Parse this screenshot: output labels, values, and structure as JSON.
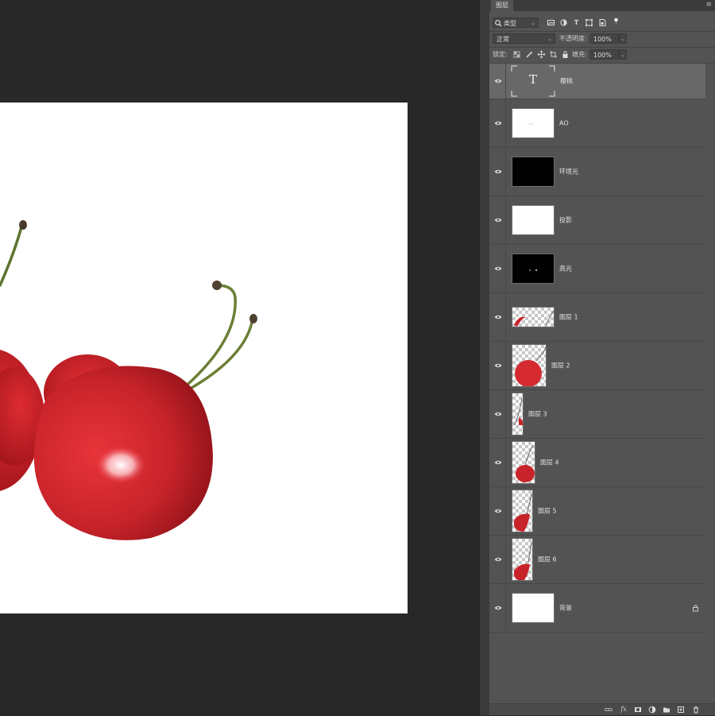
{
  "panel": {
    "tab_title": "图层",
    "menu_icon": "≡",
    "filter": {
      "kind_label": "类型",
      "icons": [
        "image-filter-icon",
        "adjustment-filter-icon",
        "text-filter-icon",
        "shape-filter-icon",
        "smart-object-filter-icon",
        "filter-toggle-icon"
      ]
    },
    "blend_mode": "正常",
    "opacity_label": "不透明度:",
    "opacity_value": "100%",
    "lock_label": "锁定:",
    "fill_label": "填充:",
    "fill_value": "100%"
  },
  "layers": [
    {
      "name": "樱桃",
      "type": "text",
      "visible": true,
      "selected": true,
      "thumb_glyph": "T"
    },
    {
      "name": "AO",
      "type": "pixel",
      "visible": true,
      "thumb": "white"
    },
    {
      "name": "环境光",
      "type": "pixel",
      "visible": true,
      "thumb": "black"
    },
    {
      "name": "投影",
      "type": "pixel",
      "visible": true,
      "thumb": "white"
    },
    {
      "name": "高光",
      "type": "pixel",
      "visible": true,
      "thumb": "black"
    },
    {
      "name": "图层 1",
      "type": "pixel",
      "visible": true,
      "thumb": "transparent"
    },
    {
      "name": "图层 2",
      "type": "pixel",
      "visible": true,
      "thumb": "transparent"
    },
    {
      "name": "图层 3",
      "type": "pixel",
      "visible": true,
      "thumb": "transparent"
    },
    {
      "name": "图层 4",
      "type": "pixel",
      "visible": true,
      "thumb": "transparent"
    },
    {
      "name": "图层 5",
      "type": "pixel",
      "visible": true,
      "thumb": "transparent"
    },
    {
      "name": "图层 6",
      "type": "pixel",
      "visible": true,
      "thumb": "transparent"
    },
    {
      "name": "背景",
      "type": "background",
      "visible": true,
      "locked": true,
      "thumb": "white"
    }
  ],
  "bottom_bar": {
    "link_icon": "⊖",
    "fx_label": "fx",
    "icons": [
      "link-layers-icon",
      "fx-icon",
      "add-mask-icon",
      "adjustment-layer-icon",
      "new-group-icon",
      "new-layer-icon",
      "delete-layer-icon"
    ]
  },
  "colors": {
    "panel_bg": "#535353",
    "workspace_bg": "#282828",
    "selected_layer": "#686868",
    "cherry_red": "#d42a30"
  }
}
